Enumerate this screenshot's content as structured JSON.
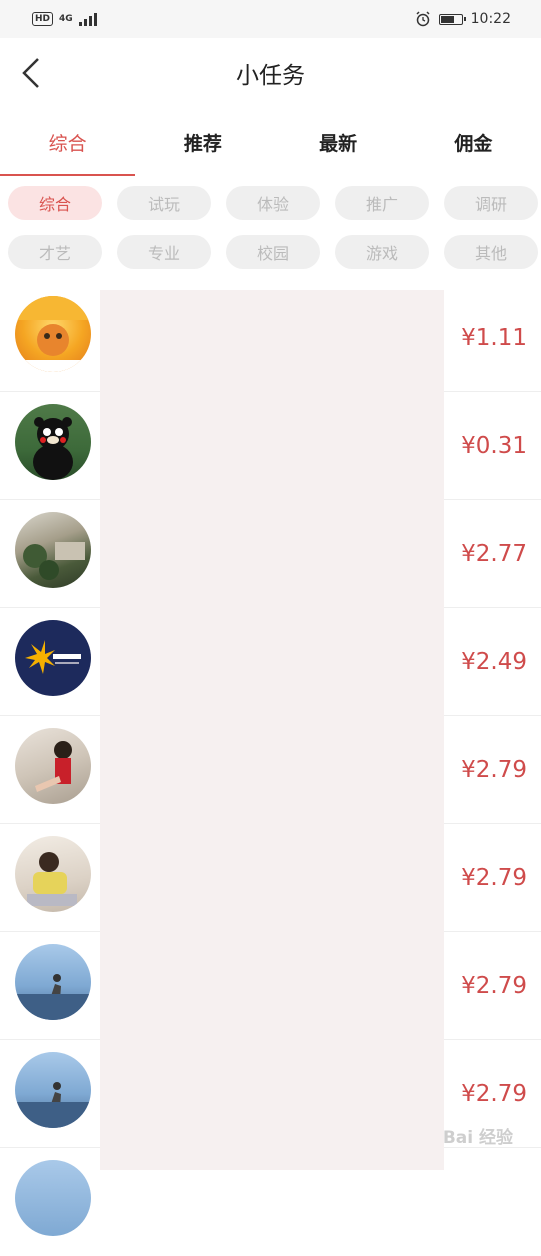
{
  "status_bar": {
    "network": "HD",
    "signal": "4G",
    "time": "10:22"
  },
  "header": {
    "title": "小任务"
  },
  "tabs": [
    {
      "label": "综合",
      "active": true
    },
    {
      "label": "推荐",
      "active": false
    },
    {
      "label": "最新",
      "active": false
    },
    {
      "label": "佣金",
      "active": false
    }
  ],
  "filters": [
    {
      "label": "综合",
      "active": true
    },
    {
      "label": "试玩"
    },
    {
      "label": "体验"
    },
    {
      "label": "推广"
    },
    {
      "label": "调研"
    },
    {
      "label": "才艺"
    },
    {
      "label": "专业"
    },
    {
      "label": "校园"
    },
    {
      "label": "游戏"
    },
    {
      "label": "其他"
    }
  ],
  "tasks": [
    {
      "price": "¥1.11"
    },
    {
      "price": "¥0.31"
    },
    {
      "price": "¥2.77"
    },
    {
      "price": "¥2.49"
    },
    {
      "price": "¥2.79"
    },
    {
      "price": "¥2.79"
    },
    {
      "price": "¥2.79"
    },
    {
      "price": "¥2.79"
    }
  ],
  "watermark": "Bai 经验",
  "colors": {
    "accent": "#d9534f",
    "price": "#cf4b4b",
    "chip_bg": "#efefef",
    "mask": "#f6f0f0"
  }
}
